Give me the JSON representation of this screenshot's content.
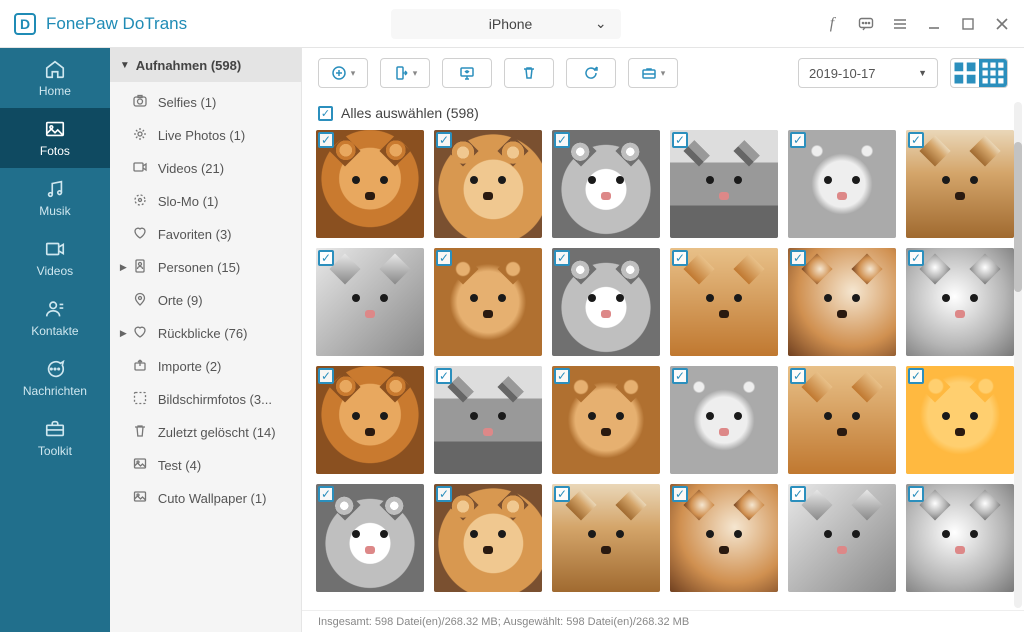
{
  "app": {
    "title": "FonePaw DoTrans"
  },
  "device": {
    "name": "iPhone"
  },
  "nav": {
    "items": [
      {
        "label": "Home"
      },
      {
        "label": "Fotos"
      },
      {
        "label": "Musik"
      },
      {
        "label": "Videos"
      },
      {
        "label": "Kontakte"
      },
      {
        "label": "Nachrichten"
      },
      {
        "label": "Toolkit"
      }
    ]
  },
  "tree": {
    "header": "Aufnahmen (598)",
    "items": [
      {
        "label": "Selfies (1)"
      },
      {
        "label": "Live Photos (1)"
      },
      {
        "label": "Videos (21)"
      },
      {
        "label": "Slo-Mo (1)"
      },
      {
        "label": "Favoriten (3)"
      },
      {
        "label": "Personen (15)"
      },
      {
        "label": "Orte (9)"
      },
      {
        "label": "Rückblicke (76)"
      },
      {
        "label": "Importe (2)"
      },
      {
        "label": "Bildschirmfotos (3..."
      },
      {
        "label": "Zuletzt gelöscht (14)"
      },
      {
        "label": "Test (4)"
      },
      {
        "label": "Cuto Wallpaper (1)"
      }
    ]
  },
  "toolbar": {
    "date": "2019-10-17"
  },
  "select": {
    "label": "Alles auswählen (598)"
  },
  "thumbs": [
    {
      "k": "dog1"
    },
    {
      "k": "dog2"
    },
    {
      "k": "cat1"
    },
    {
      "k": "cat2"
    },
    {
      "k": "cat3"
    },
    {
      "k": "dog3"
    },
    {
      "k": "cat4"
    },
    {
      "k": "dog4"
    },
    {
      "k": "cat1"
    },
    {
      "k": "dog5"
    },
    {
      "k": "dog6"
    },
    {
      "k": "cat5"
    },
    {
      "k": "dog1"
    },
    {
      "k": "cat2"
    },
    {
      "k": "dog4"
    },
    {
      "k": "cat3"
    },
    {
      "k": "dog5"
    },
    {
      "k": "cartoon"
    },
    {
      "k": "cat1"
    },
    {
      "k": "dog2"
    },
    {
      "k": "dog3"
    },
    {
      "k": "dog6"
    },
    {
      "k": "cat4"
    },
    {
      "k": "cat5"
    }
  ],
  "status": {
    "text": "Insgesamt: 598 Datei(en)/268.32 MB; Ausgewählt: 598 Datei(en)/268.32 MB"
  }
}
